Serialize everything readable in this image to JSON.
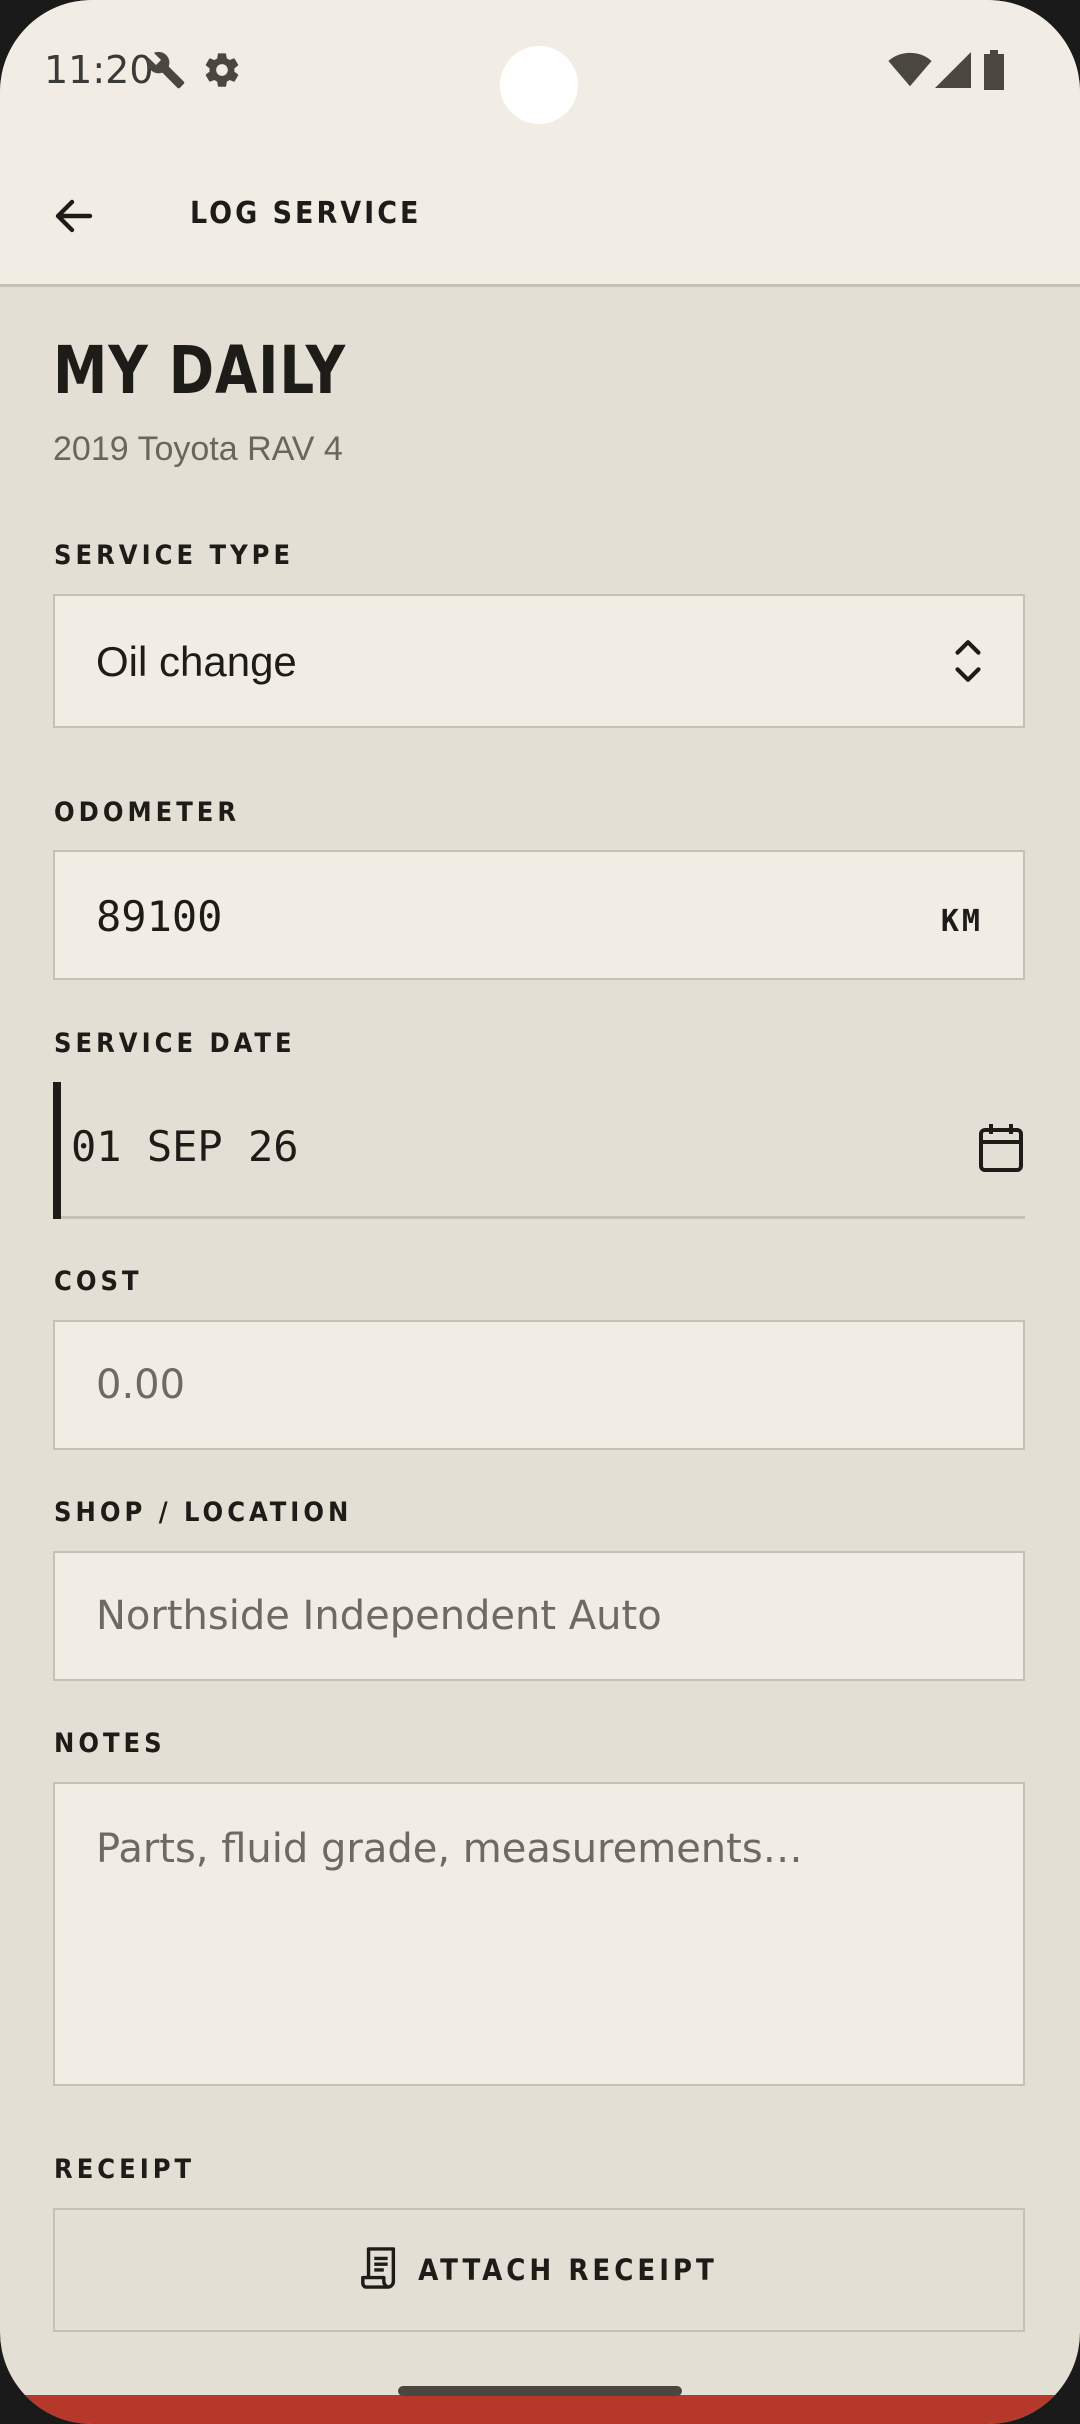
{
  "status_bar": {
    "time": "11:20"
  },
  "app_bar": {
    "title": "LOG SERVICE"
  },
  "vehicle": {
    "name": "MY DAILY",
    "details": "2019 Toyota RAV 4"
  },
  "form": {
    "service_type": {
      "label": "SERVICE TYPE",
      "value": "Oil change"
    },
    "odometer": {
      "label": "ODOMETER",
      "value": "89100",
      "unit": "KM"
    },
    "service_date": {
      "label": "SERVICE DATE",
      "value": "01 SEP 26"
    },
    "cost": {
      "label": "COST",
      "placeholder": "0.00"
    },
    "shop": {
      "label": "SHOP / LOCATION",
      "placeholder": "Northside Independent Auto"
    },
    "notes": {
      "label": "NOTES",
      "placeholder": "Parts, fluid grade, measurements…"
    },
    "receipt": {
      "label": "RECEIPT",
      "button_label": "ATTACH RECEIPT"
    }
  },
  "icons": {
    "back": "arrow-back-icon",
    "select": "unfold-icon",
    "calendar": "calendar-icon",
    "receipt": "receipt-icon"
  },
  "colors": {
    "background": "#e3dfd4",
    "surface": "#f1ede5",
    "border": "#c6c1b6",
    "text": "#1e1c18",
    "accent": "#b5382a"
  }
}
